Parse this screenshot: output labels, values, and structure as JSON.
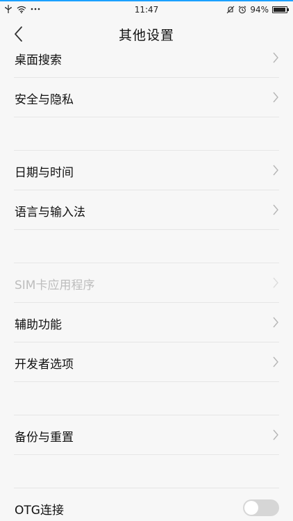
{
  "status_bar": {
    "time": "11:47",
    "battery_percent": "94%",
    "battery_level": 0.94,
    "icons": [
      "usb-icon",
      "wifi-icon",
      "more-dots-icon",
      "mute-icon",
      "alarm-icon",
      "battery-icon"
    ]
  },
  "nav": {
    "title": "其他设置",
    "back_icon": "chevron-left-icon"
  },
  "rows": [
    {
      "label": "桌面搜索",
      "type": "chevron",
      "enabled": true
    },
    {
      "label": "安全与隐私",
      "type": "chevron",
      "enabled": true
    },
    {
      "label": "日期与时间",
      "type": "chevron",
      "enabled": true
    },
    {
      "label": "语言与输入法",
      "type": "chevron",
      "enabled": true
    },
    {
      "label": "SIM卡应用程序",
      "type": "chevron",
      "enabled": false
    },
    {
      "label": "辅助功能",
      "type": "chevron",
      "enabled": true
    },
    {
      "label": "开发者选项",
      "type": "chevron",
      "enabled": true
    },
    {
      "label": "备份与重置",
      "type": "chevron",
      "enabled": true
    },
    {
      "label": "OTG连接",
      "type": "toggle",
      "enabled": true,
      "toggle_on": false
    }
  ],
  "colors": {
    "background": "#f7f7f7",
    "text": "#111111",
    "disabled_text": "#bdbdbd",
    "divider": "#e6e6e6",
    "chevron": "#b5b5b5",
    "status_accent": "#1aa0ff"
  }
}
